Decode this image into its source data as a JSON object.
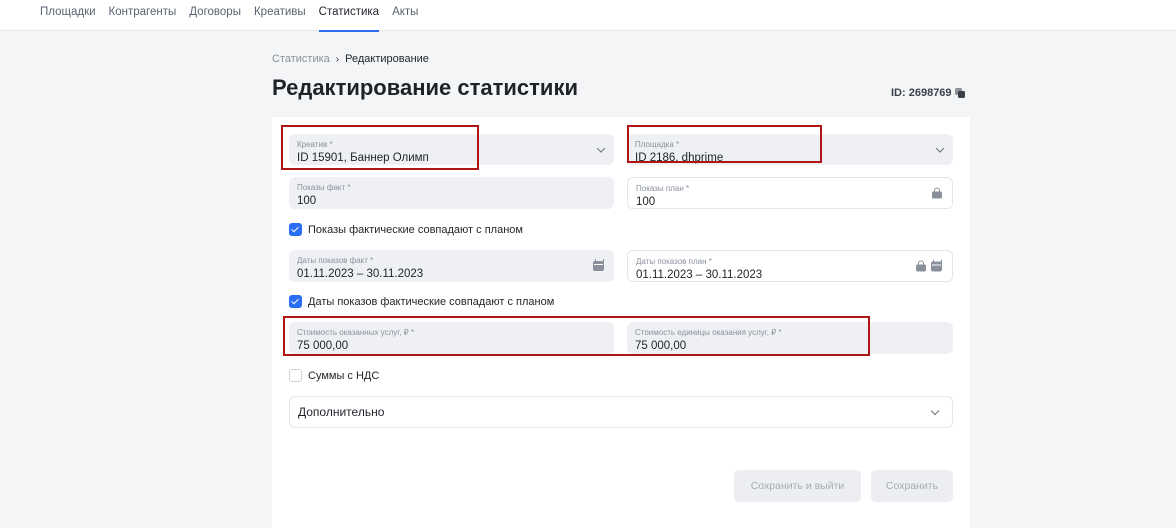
{
  "nav": {
    "tabs": [
      {
        "label": "Площадки"
      },
      {
        "label": "Контрагенты"
      },
      {
        "label": "Договоры"
      },
      {
        "label": "Креативы"
      },
      {
        "label": "Статистика"
      },
      {
        "label": "Акты"
      }
    ],
    "active_index": 4
  },
  "breadcrumb": {
    "parent": "Статистика",
    "separator": "›",
    "current": "Редактирование"
  },
  "page": {
    "title": "Редактирование статистики",
    "record_id": "ID: 2698769"
  },
  "form": {
    "creative": {
      "label": "Креатив *",
      "value": "ID 15901, Баннер Олимп"
    },
    "platform": {
      "label": "Площадка *",
      "value": "ID 2186, dhprime"
    },
    "impressions_fact": {
      "label": "Показы факт *",
      "value": "100"
    },
    "impressions_plan": {
      "label": "Показы план *",
      "value": "100"
    },
    "impressions_match": {
      "label": "Показы фактические совпадают с планом",
      "checked": true
    },
    "dates_fact": {
      "label": "Даты показов факт *",
      "value": "01.11.2023 – 30.11.2023"
    },
    "dates_plan": {
      "label": "Даты показов план *",
      "value": "01.11.2023 – 30.11.2023"
    },
    "dates_match": {
      "label": "Даты показов фактические совпадают с планом",
      "checked": true
    },
    "services_cost": {
      "label": "Стоимость оказанных услуг, ₽ *",
      "value": "75 000,00"
    },
    "unit_cost": {
      "label": "Стоимость единицы оказания услуг, ₽ *",
      "value": "75 000,00"
    },
    "vat": {
      "label": "Суммы с НДС",
      "checked": false
    },
    "additional": {
      "label": "Дополнительно"
    }
  },
  "buttons": {
    "save_exit": "Сохранить и выйти",
    "save": "Сохранить"
  },
  "colors": {
    "accent": "#2a6ef5",
    "highlight": "#b01515"
  }
}
